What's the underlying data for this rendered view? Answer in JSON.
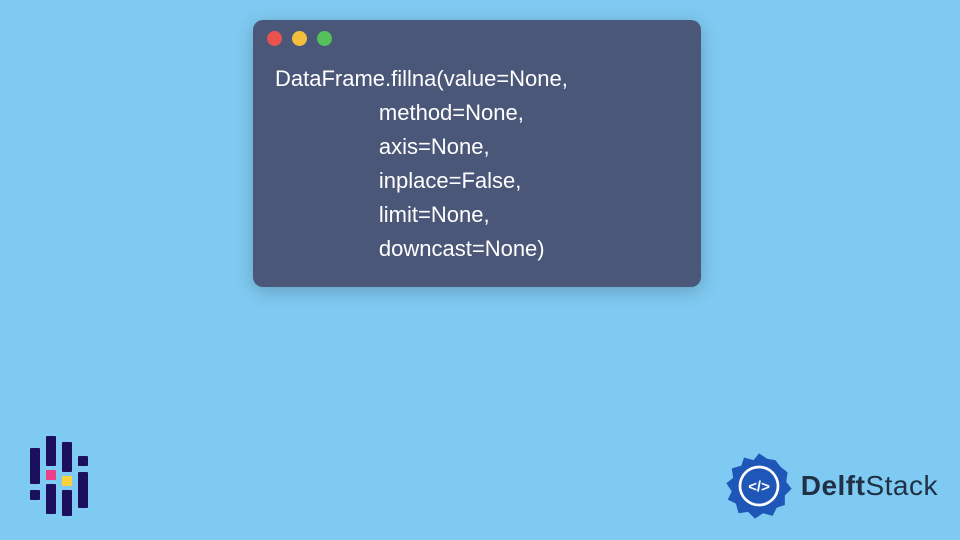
{
  "code_window": {
    "traffic_lights": [
      "red",
      "yellow",
      "green"
    ],
    "lines": [
      "DataFrame.fillna(value=None,",
      "                 method=None,",
      "                 axis=None,",
      "                 inplace=False,",
      "                 limit=None,",
      "                 downcast=None)"
    ]
  },
  "logos": {
    "left": "pandas-logo",
    "right_name_bold": "Delft",
    "right_name_light": "Stack",
    "right_badge_text": "</>"
  },
  "colors": {
    "page_bg": "#7fcaf2",
    "window_bg": "#4b5778",
    "code_fg": "#ffffff",
    "brand_blue": "#1f57b8"
  }
}
